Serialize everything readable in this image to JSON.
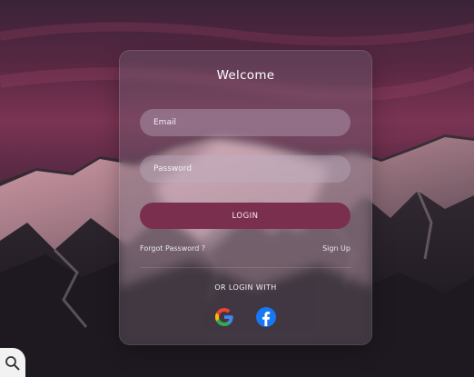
{
  "login_card": {
    "title": "Welcome",
    "email_placeholder": "Email",
    "password_placeholder": "Password",
    "login_label": "LOGIN",
    "forgot_password_label": "Forgot Password ?",
    "signup_label": "Sign Up",
    "or_login_with_label": "OR LOGIN WITH",
    "social_icons": [
      "google-icon",
      "facebook-icon"
    ]
  },
  "colors": {
    "login_button": "#7a2f4f",
    "sky_top": "#3e2540",
    "sky_mid": "#6e2f4d",
    "facebook_blue": "#1877f2"
  },
  "corner_icon": "visual-search-icon"
}
